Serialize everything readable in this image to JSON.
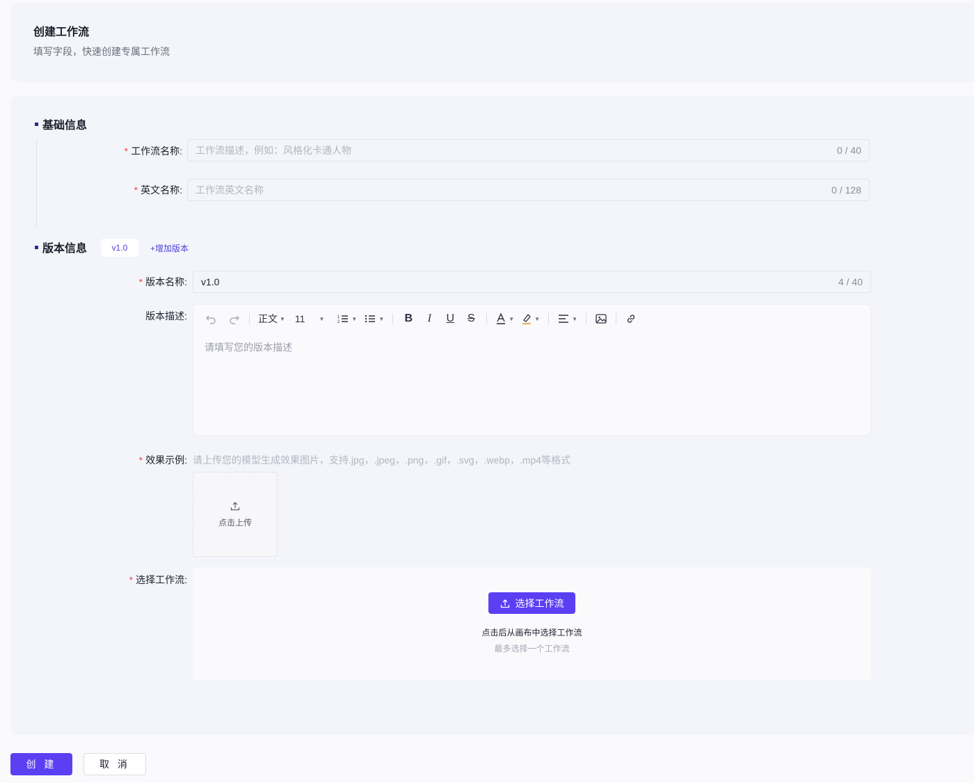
{
  "header": {
    "title": "创建工作流",
    "subtitle": "填写字段，快速创建专属工作流"
  },
  "basic_section": {
    "title": "基础信息",
    "name_field": {
      "label": "工作流名称:",
      "placeholder": "工作流描述，例如：风格化卡通人物",
      "value": "",
      "count": "0 / 40"
    },
    "en_name_field": {
      "label": "英文名称:",
      "placeholder": "工作流英文名称",
      "value": "",
      "count": "0 / 128"
    }
  },
  "version_section": {
    "title": "版本信息",
    "active_version_tag": "v1.0",
    "add_version_label": "+增加版本",
    "version_name_field": {
      "label": "版本名称:",
      "value": "v1.0",
      "count": "4 / 40"
    },
    "description_field": {
      "label": "版本描述:",
      "placeholder": "请填写您的版本描述",
      "toolbar": {
        "paragraph_style": "正文",
        "font_size": "11"
      }
    },
    "effect_example": {
      "label": "效果示例:",
      "hint": "请上传您的模型生成效果图片，支持.jpg，.jpeg，.png，.gif，.svg，.webp，.mp4等格式",
      "upload_label": "点击上传"
    },
    "workflow_select": {
      "label": "选择工作流:",
      "button_label": "选择工作流",
      "description": "点击后从画布中选择工作流",
      "sub_description": "最多选择一个工作流"
    }
  },
  "footer": {
    "create_label": "创 建",
    "cancel_label": "取 消"
  },
  "colors": {
    "primary": "#5b3ff3",
    "required": "#e5484d",
    "card_bg": "#f4f5fa"
  }
}
